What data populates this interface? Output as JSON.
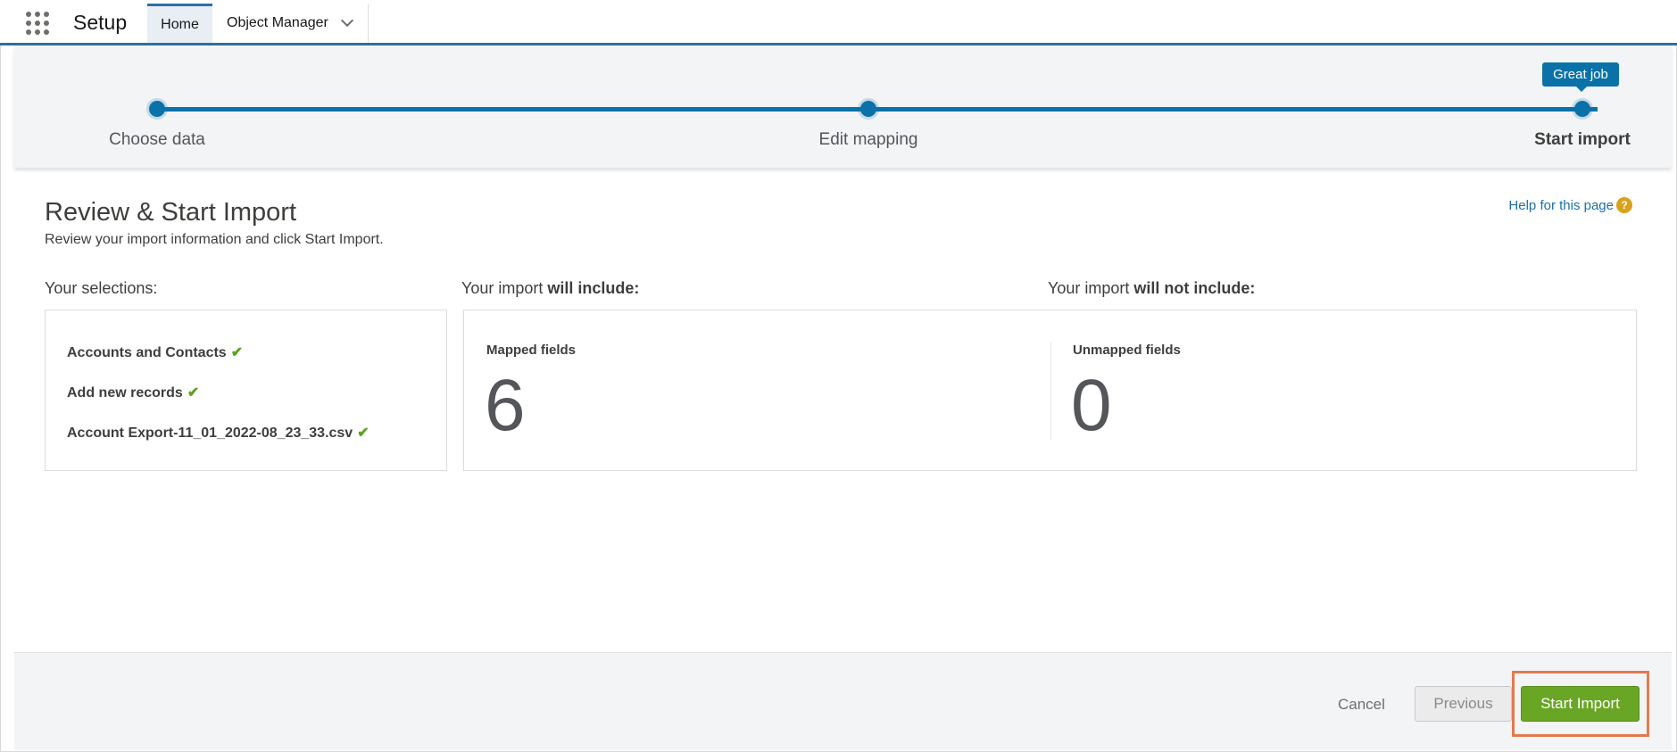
{
  "nav": {
    "app_title": "Setup",
    "tabs": [
      {
        "label": "Home"
      },
      {
        "label": "Object Manager"
      }
    ]
  },
  "progress": {
    "steps": [
      {
        "label": "Choose data"
      },
      {
        "label": "Edit mapping"
      },
      {
        "label": "Start import"
      }
    ],
    "current_step": 3,
    "tooltip": "Great job"
  },
  "page": {
    "title": "Review & Start Import",
    "subtitle": "Review your import information and click Start Import.",
    "help_link": "Help for this page"
  },
  "selections": {
    "heading": "Your selections:",
    "items": [
      "Accounts and Contacts",
      "Add new records",
      "Account Export-11_01_2022-08_23_33.csv"
    ]
  },
  "include": {
    "heading_prefix": "Your import ",
    "heading_bold": "will include:",
    "label": "Mapped fields",
    "count": "6"
  },
  "exclude": {
    "heading_prefix": "Your import ",
    "heading_bold": "will not include:",
    "label": "Unmapped fields",
    "count": "0"
  },
  "footer": {
    "cancel": "Cancel",
    "previous": "Previous",
    "start": "Start Import"
  },
  "colors": {
    "accent": "#0a72a8",
    "start_button": "#6aa625",
    "highlight": "#e37a4d"
  }
}
